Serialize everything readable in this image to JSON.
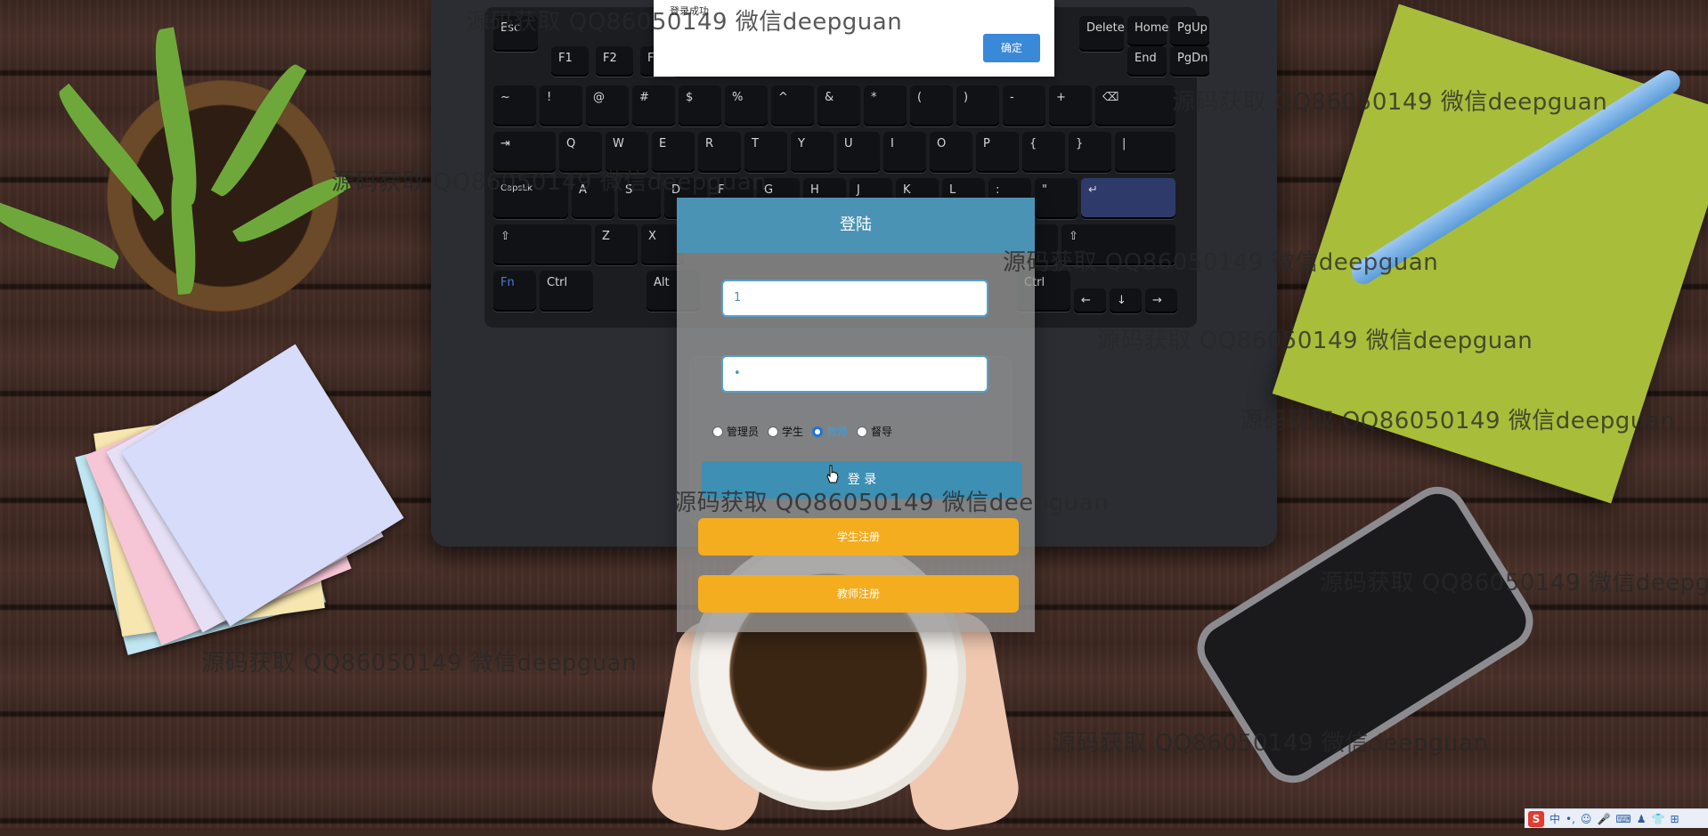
{
  "dialog": {
    "message": "登录成功",
    "ok_label": "确定"
  },
  "login_panel": {
    "title": "登陆",
    "username_value": "1",
    "password_value": "•",
    "roles": [
      {
        "label": "管理员",
        "checked": false
      },
      {
        "label": "学生",
        "checked": false
      },
      {
        "label": "教师",
        "checked": true
      },
      {
        "label": "督导",
        "checked": false
      }
    ],
    "login_button": "登 录",
    "student_register_button": "学生注册",
    "teacher_register_button": "教师注册"
  },
  "watermark_text": "源码获取 QQ86050149 微信deepguan",
  "keyboard": {
    "row0": [
      "Esc",
      "F1",
      "F2",
      "F3",
      "Delete",
      "Home",
      "PgUp",
      "End",
      "PgDn"
    ],
    "row1": [
      "~",
      "!",
      "@",
      "#",
      "$",
      "%",
      "^",
      "&",
      "*",
      "(",
      ")",
      "-",
      "+",
      "⌫"
    ],
    "row2": [
      "⇥",
      "Q",
      "W",
      "E",
      "R",
      "T",
      "Y",
      "U",
      "I",
      "O",
      "P",
      "{",
      "}",
      "|"
    ],
    "row3": [
      "CapsLk",
      "A",
      "S",
      "D",
      "F",
      "G",
      "H",
      "J",
      "K",
      "L",
      ":",
      "\"",
      "↵"
    ],
    "row4": [
      "⇧",
      "Z",
      "X",
      "?",
      "⇧"
    ],
    "row5": [
      "Fn",
      "Ctrl",
      "Alt",
      "Ctrl",
      "←",
      "↓",
      "→"
    ]
  },
  "ime": {
    "logo": "S",
    "items": [
      "中",
      "•,",
      "☺",
      "🎤",
      "⌨",
      "♟",
      "👕",
      "⊞"
    ]
  },
  "colors": {
    "panel_header": "#4b93b4",
    "login_button": "#3d8fb3",
    "register_button": "#f4ad1f",
    "dialog_ok": "#3a88d8"
  }
}
